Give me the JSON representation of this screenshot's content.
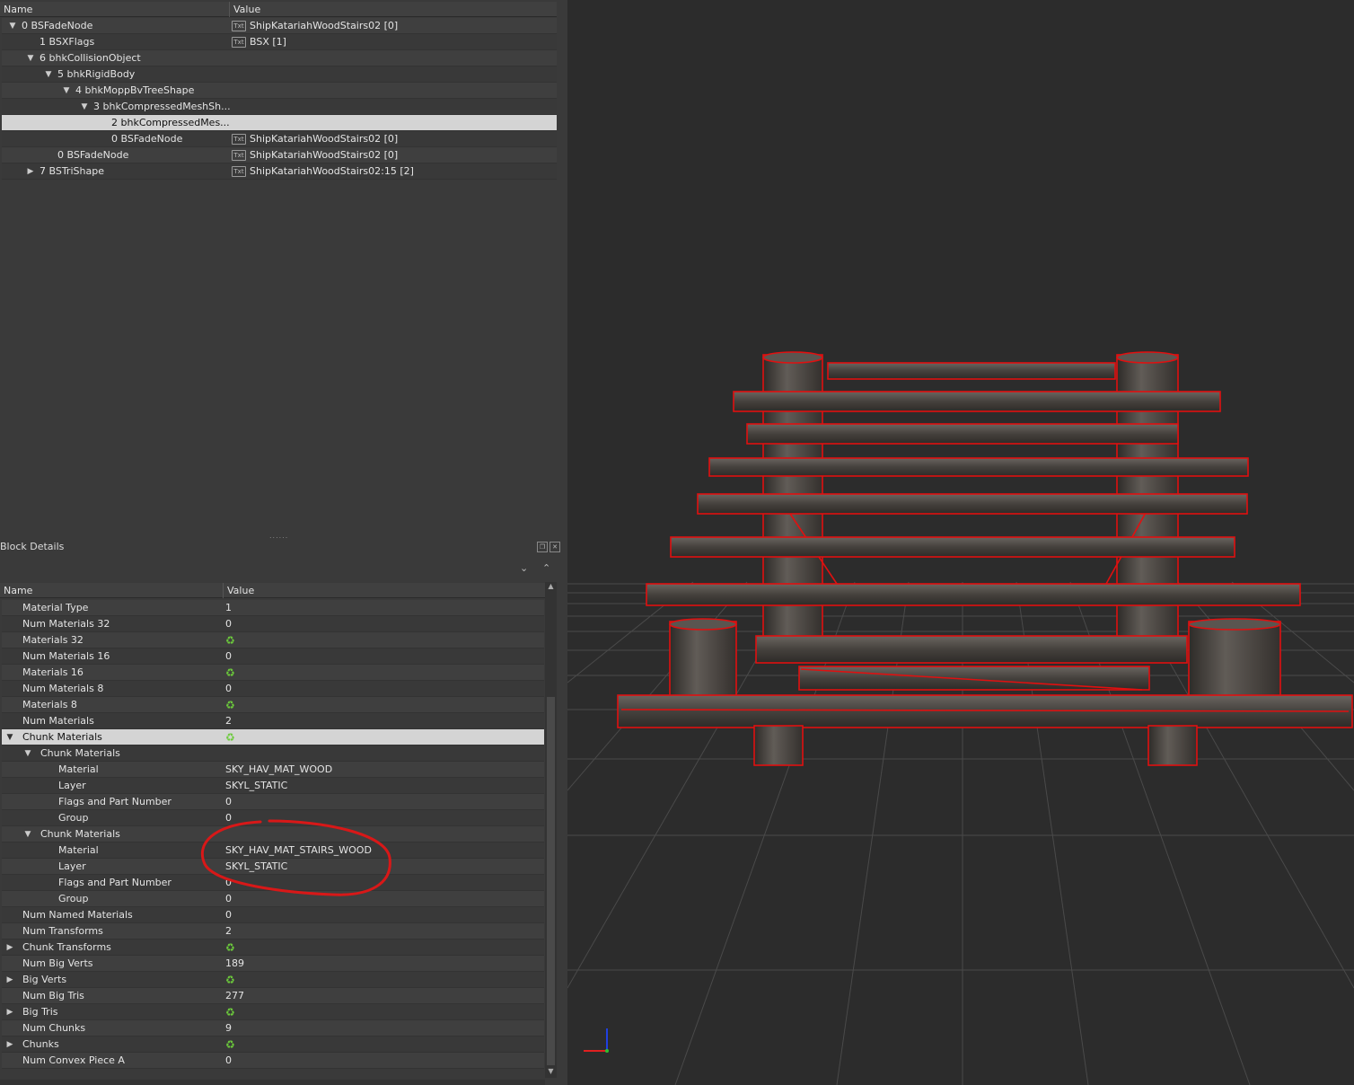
{
  "tree": {
    "header": {
      "name": "Name",
      "value": "Value"
    },
    "rows": [
      {
        "label": "0 BSFadeNode",
        "value": "ShipKatariahWoodStairs02 [0]",
        "indent": 0,
        "arrow": "down",
        "txt": true
      },
      {
        "label": "1 BSXFlags",
        "value": "BSX [1]",
        "indent": 1,
        "arrow": "",
        "txt": true
      },
      {
        "label": "6 bhkCollisionObject",
        "value": "",
        "indent": 1,
        "arrow": "down",
        "txt": false
      },
      {
        "label": "5 bhkRigidBody",
        "value": "",
        "indent": 2,
        "arrow": "down",
        "txt": false
      },
      {
        "label": "4 bhkMoppBvTreeShape",
        "value": "",
        "indent": 3,
        "arrow": "down",
        "txt": false
      },
      {
        "label": "3 bhkCompressedMeshSh...",
        "value": "",
        "indent": 4,
        "arrow": "down",
        "txt": false
      },
      {
        "label": "2 bhkCompressedMes...",
        "value": "",
        "indent": 5,
        "arrow": "",
        "txt": false,
        "selected": true
      },
      {
        "label": "0 BSFadeNode",
        "value": "ShipKatariahWoodStairs02 [0]",
        "indent": 5,
        "arrow": "",
        "txt": true
      },
      {
        "label": "0 BSFadeNode",
        "value": "ShipKatariahWoodStairs02 [0]",
        "indent": 2,
        "arrow": "",
        "txt": true
      },
      {
        "label": "7 BSTriShape",
        "value": "ShipKatariahWoodStairs02:15 [2]",
        "indent": 1,
        "arrow": "right",
        "txt": true
      }
    ],
    "txt_icon": "Txt"
  },
  "block_details": {
    "title": "Block Details",
    "header": {
      "name": "Name",
      "value": "Value"
    },
    "rows": [
      {
        "label": "Material Type",
        "value": "1",
        "indent": 1,
        "arrow": ""
      },
      {
        "label": "Num Materials 32",
        "value": "0",
        "indent": 1,
        "arrow": ""
      },
      {
        "label": "Materials 32",
        "value": "",
        "indent": 1,
        "arrow": "",
        "icon": "refresh"
      },
      {
        "label": "Num Materials 16",
        "value": "0",
        "indent": 1,
        "arrow": ""
      },
      {
        "label": "Materials 16",
        "value": "",
        "indent": 1,
        "arrow": "",
        "icon": "refresh"
      },
      {
        "label": "Num Materials 8",
        "value": "0",
        "indent": 1,
        "arrow": ""
      },
      {
        "label": "Materials 8",
        "value": "",
        "indent": 1,
        "arrow": "",
        "icon": "refresh"
      },
      {
        "label": "Num Materials",
        "value": "2",
        "indent": 1,
        "arrow": ""
      },
      {
        "label": "Chunk Materials",
        "value": "",
        "indent": 1,
        "arrow": "down",
        "icon": "refresh",
        "selected": true
      },
      {
        "label": "Chunk Materials",
        "value": "",
        "indent": 2,
        "arrow": "down"
      },
      {
        "label": "Material",
        "value": "SKY_HAV_MAT_WOOD",
        "indent": 3,
        "arrow": ""
      },
      {
        "label": "Layer",
        "value": "SKYL_STATIC",
        "indent": 3,
        "arrow": ""
      },
      {
        "label": "Flags and Part Number",
        "value": "0",
        "indent": 3,
        "arrow": ""
      },
      {
        "label": "Group",
        "value": "0",
        "indent": 3,
        "arrow": ""
      },
      {
        "label": "Chunk Materials",
        "value": "",
        "indent": 2,
        "arrow": "down"
      },
      {
        "label": "Material",
        "value": "SKY_HAV_MAT_STAIRS_WOOD",
        "indent": 3,
        "arrow": ""
      },
      {
        "label": "Layer",
        "value": "SKYL_STATIC",
        "indent": 3,
        "arrow": ""
      },
      {
        "label": "Flags and Part Number",
        "value": "0",
        "indent": 3,
        "arrow": ""
      },
      {
        "label": "Group",
        "value": "0",
        "indent": 3,
        "arrow": ""
      },
      {
        "label": "Num Named Materials",
        "value": "0",
        "indent": 1,
        "arrow": ""
      },
      {
        "label": "Num Transforms",
        "value": "2",
        "indent": 1,
        "arrow": ""
      },
      {
        "label": "Chunk Transforms",
        "value": "",
        "indent": 1,
        "arrow": "right",
        "icon": "refresh"
      },
      {
        "label": "Num Big Verts",
        "value": "189",
        "indent": 1,
        "arrow": ""
      },
      {
        "label": "Big Verts",
        "value": "",
        "indent": 1,
        "arrow": "right",
        "icon": "refresh"
      },
      {
        "label": "Num Big Tris",
        "value": "277",
        "indent": 1,
        "arrow": ""
      },
      {
        "label": "Big Tris",
        "value": "",
        "indent": 1,
        "arrow": "right",
        "icon": "refresh"
      },
      {
        "label": "Num Chunks",
        "value": "9",
        "indent": 1,
        "arrow": ""
      },
      {
        "label": "Chunks",
        "value": "",
        "indent": 1,
        "arrow": "right",
        "icon": "refresh"
      },
      {
        "label": "Num Convex Piece A",
        "value": "0",
        "indent": 1,
        "arrow": ""
      }
    ]
  },
  "icons": {
    "refresh": "refresh-icon",
    "txt": "txt-icon",
    "expand": "triangle-down-icon",
    "collapse": "triangle-right-icon"
  },
  "colors": {
    "wireframe": "#e01010",
    "wood": "#4a4642",
    "selection": "#d4d4d4",
    "annotation": "#d81818",
    "refresh": "#6ccb3c"
  }
}
